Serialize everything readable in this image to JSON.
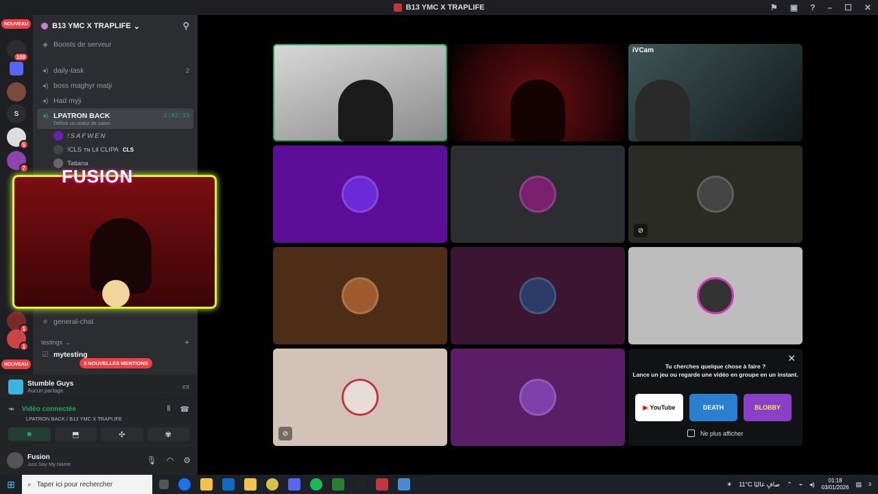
{
  "window": {
    "title": "B13 YMC X TRAPLIFE"
  },
  "guilds": {
    "new_label": "NOUVEAU",
    "badges": [
      "109",
      "5",
      "7",
      "1",
      "1"
    ],
    "letter_guild": "S"
  },
  "server": {
    "name": "B13 YMC X TRAPLIFE",
    "boosts": "Boosts de serveur",
    "channels": [
      {
        "name": "daily-task",
        "count": "2"
      },
      {
        "name": "boss maghyr matji",
        "count": ""
      },
      {
        "name": "Had myji",
        "count": ""
      }
    ],
    "active_channel": {
      "name": "LPATRON BACK",
      "timer": "2:42:33",
      "status": "Définir un statut de salon"
    },
    "voice_users": [
      "!SAFWEN",
      "!CLS ᴛɴ Lil CLIPA",
      "Tatiana"
    ],
    "cls_tag": "CLS",
    "overlay_title": "FUSION",
    "general_chat": "general-chat",
    "category": "testings",
    "mytesting": "mytesting",
    "mentions": "3 NOUVELLES MENTIONS"
  },
  "activity": {
    "game": "Stumble Guys",
    "sub": "Aucun partage"
  },
  "voice": {
    "status": "Vidéo connectée",
    "location": "LPATRON BACK / B13 YMC X TRAPLIFE"
  },
  "user": {
    "name": "Fusion",
    "status": "Just Say My Name"
  },
  "grid": {
    "cam_label": "iVCam"
  },
  "promo": {
    "line1": "Tu cherches quelque chose à faire ?",
    "line2": "Lance un jeu ou regarde une vidéo en groupe en un instant.",
    "apps": [
      "YouTube",
      "DEATH",
      "BLOBBY"
    ],
    "checkbox": "Ne plus afficher"
  },
  "taskbar": {
    "search_placeholder": "Taper ici pour rechercher",
    "weather": "11°C  صافٍ غالبًا",
    "time": "01:18",
    "date": "03/01/2026",
    "notif": "3"
  }
}
